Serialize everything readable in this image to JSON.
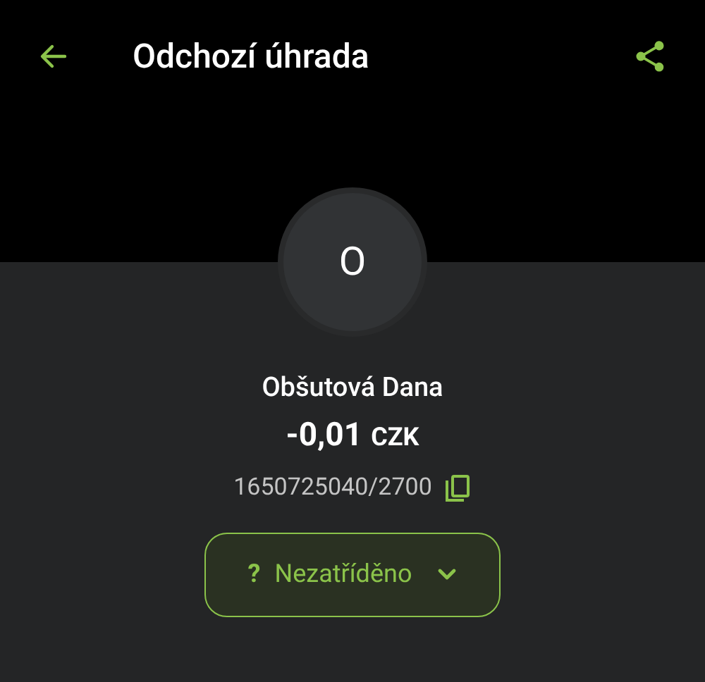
{
  "header": {
    "title": "Odchozí úhrada"
  },
  "avatar": {
    "initial": "O"
  },
  "counterparty": {
    "name": "Obšutová Dana",
    "amount": "-0,01",
    "currency": "CZK",
    "account": "1650725040/2700"
  },
  "category": {
    "icon": "?",
    "label": "Nezatříděno"
  }
}
